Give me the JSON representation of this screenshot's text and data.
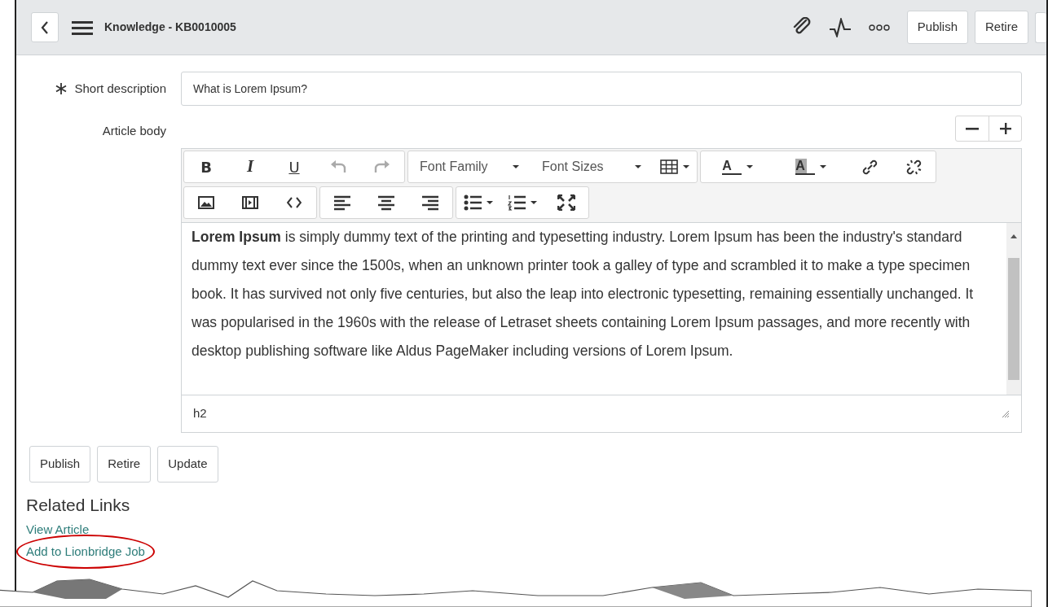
{
  "header": {
    "title": "Knowledge - KB0010005",
    "buttons": [
      "Publish",
      "Retire"
    ]
  },
  "form": {
    "short_description": {
      "label": "Short description",
      "required": true,
      "value": "What is Lorem Ipsum?"
    },
    "article_body": {
      "label": "Article body",
      "toolbar_rows": [
        [
          [
            {
              "kind": "bold",
              "label": "B",
              "disabled": false
            },
            {
              "kind": "italic",
              "label": "I",
              "disabled": false
            },
            {
              "kind": "underline",
              "label": "U",
              "disabled": false
            },
            {
              "kind": "undo",
              "disabled": true
            },
            {
              "kind": "redo",
              "disabled": true
            }
          ],
          [
            {
              "kind": "dropdown",
              "label": "Font Family"
            },
            {
              "kind": "dropdown",
              "label": "Font Sizes"
            },
            {
              "kind": "table"
            }
          ],
          [
            {
              "kind": "textcolor",
              "label": "A"
            },
            {
              "kind": "bgcolor",
              "label": "A"
            },
            {
              "kind": "link"
            },
            {
              "kind": "unlink"
            }
          ]
        ],
        [
          [
            {
              "kind": "image"
            },
            {
              "kind": "media"
            },
            {
              "kind": "code"
            }
          ],
          [
            {
              "kind": "align-left"
            },
            {
              "kind": "align-center"
            },
            {
              "kind": "align-right"
            }
          ],
          [
            {
              "kind": "bullets"
            },
            {
              "kind": "numbers"
            },
            {
              "kind": "fullscreen"
            }
          ]
        ]
      ],
      "content": "**Lorem Ipsum** is simply dummy text of the printing and typesetting industry. Lorem Ipsum has been the industry's standard dummy text ever since the 1500s, when an unknown printer took a galley of type and scrambled it to make a type specimen book. It has survived not only five centuries, but also the leap into electronic typesetting, remaining essentially unchanged. It was popularised in the 1960s with the release of Letraset sheets containing Lorem Ipsum passages, and more recently with desktop publishing software like Aldus PageMaker including versions of Lorem Ipsum.",
      "status_path": "h2"
    }
  },
  "actions": [
    "Publish",
    "Retire",
    "Update"
  ],
  "related_links": {
    "title": "Related Links",
    "links": [
      {
        "label": "View Article",
        "highlighted": false
      },
      {
        "label": "Add to Lionbridge Job",
        "highlighted": true
      }
    ]
  }
}
